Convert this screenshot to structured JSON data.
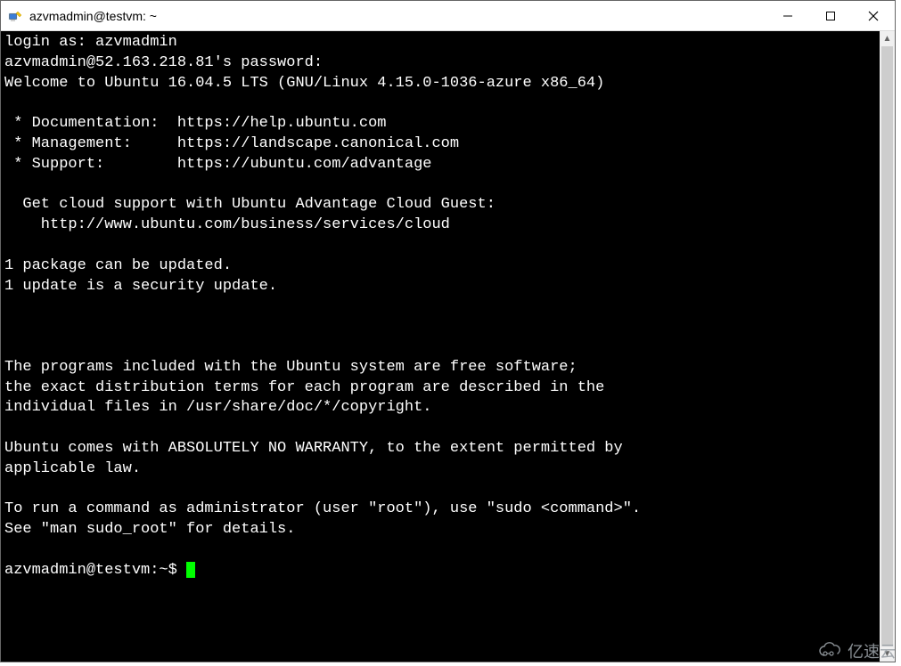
{
  "window": {
    "title": "azvmadmin@testvm: ~"
  },
  "terminal": {
    "lines": {
      "l0": "login as: azvmadmin",
      "l1": "azvmadmin@52.163.218.81's password:",
      "l2": "Welcome to Ubuntu 16.04.5 LTS (GNU/Linux 4.15.0-1036-azure x86_64)",
      "l3": "",
      "l4": " * Documentation:  https://help.ubuntu.com",
      "l5": " * Management:     https://landscape.canonical.com",
      "l6": " * Support:        https://ubuntu.com/advantage",
      "l7": "",
      "l8": "  Get cloud support with Ubuntu Advantage Cloud Guest:",
      "l9": "    http://www.ubuntu.com/business/services/cloud",
      "l10": "",
      "l11": "1 package can be updated.",
      "l12": "1 update is a security update.",
      "l13": "",
      "l14": "",
      "l15": "",
      "l16": "The programs included with the Ubuntu system are free software;",
      "l17": "the exact distribution terms for each program are described in the",
      "l18": "individual files in /usr/share/doc/*/copyright.",
      "l19": "",
      "l20": "Ubuntu comes with ABSOLUTELY NO WARRANTY, to the extent permitted by",
      "l21": "applicable law.",
      "l22": "",
      "l23": "To run a command as administrator (user \"root\"), use \"sudo <command>\".",
      "l24": "See \"man sudo_root\" for details.",
      "l25": ""
    },
    "prompt": "azvmadmin@testvm:~$ "
  },
  "watermark": {
    "text": "亿速云"
  }
}
